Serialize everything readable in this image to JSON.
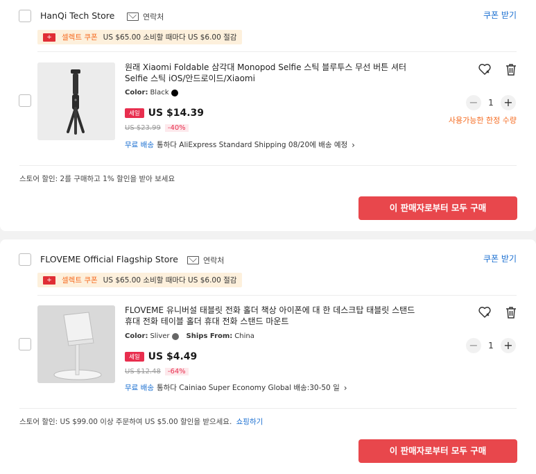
{
  "stores": [
    {
      "name": "HanQi Tech Store",
      "contact_label": "연락처",
      "coupon_label": "쿠폰 받기",
      "banner": {
        "flag": "+",
        "tag": "셀렉트 쿠폰",
        "text": "US $65.00 소비할 때마다 US $6.00 절감"
      },
      "item": {
        "title": "원래 Xiaomi Foldable 삼각대 Monopod Selfie 스틱 블루투스 무선 버튼 셔터 Selfie 스틱 iOS/안드로이드/Xiaomi",
        "attr_label": "Color:",
        "attr_value": "Black",
        "attr_color": "#000000",
        "ships_label": "",
        "ships_value": "",
        "sale_badge": "세일",
        "price": "US $14.39",
        "original_price": "US $23.99",
        "discount": "-40%",
        "ship_free": "무료 배송",
        "ship_text": "통하다 AliExpress Standard Shipping 08/20에 배송 예정",
        "quantity": "1",
        "limit_note": "사용가능한 한정 수량"
      },
      "store_discount": {
        "text": "스토어 할인: 2를 구매하고 1% 할인을 받아 보세요",
        "link": ""
      },
      "buy_all": "이 판매자로부터 모두 구매"
    },
    {
      "name": "FLOVEME Official Flagship Store",
      "contact_label": "연락처",
      "coupon_label": "쿠폰 받기",
      "banner": {
        "flag": "+",
        "tag": "셀렉트 쿠폰",
        "text": "US $65.00 소비할 때마다 US $6.00 절감"
      },
      "item": {
        "title": "FLOVEME 유니버설 태블릿 전화 홀더 책상 아이폰에 대 한 데스크탑 태블릿 스탠드 휴대 전화 테이블 홀더 휴대 전화 스탠드 마운트",
        "attr_label": "Color:",
        "attr_value": "Sliver",
        "attr_color": "#666666",
        "ships_label": "Ships From:",
        "ships_value": "China",
        "sale_badge": "세일",
        "price": "US $4.49",
        "original_price": "US $12.48",
        "discount": "-64%",
        "ship_free": "무료 배송",
        "ship_text": "통하다 Cainiao Super Economy Global 배송:30-50 일",
        "quantity": "1",
        "limit_note": ""
      },
      "store_discount": {
        "text": "스토어 할인: US $99.00 이상 주문하여 US $5.00 할인을 받으세요.",
        "link": "쇼핑하기"
      },
      "buy_all": "이 판매자로부터 모두 구매"
    }
  ],
  "icons": {
    "wishlist": "heart-icon",
    "delete": "trash-icon",
    "chevron": "chevron-right-icon",
    "contact": "mail-icon"
  },
  "colors": {
    "accent": "#e8474c",
    "link": "#1a6fd1",
    "sale": "#e82e4e",
    "orange": "#f56a1f"
  }
}
